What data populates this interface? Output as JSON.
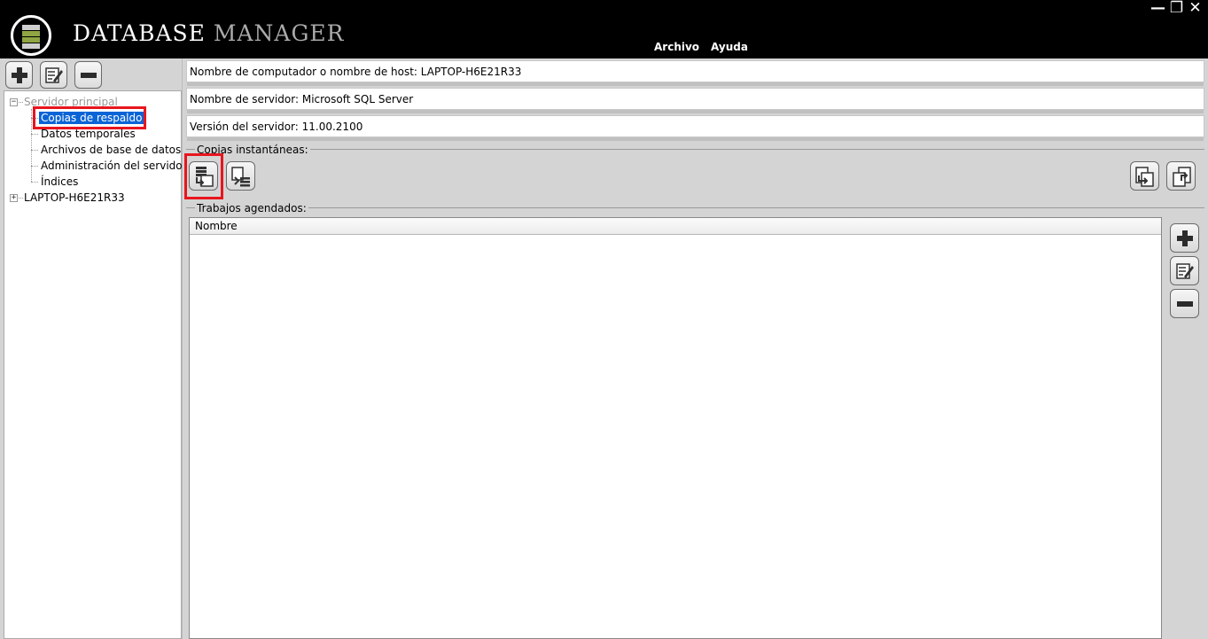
{
  "app": {
    "title_part1": "DATABASE",
    "title_part2": "MANAGER",
    "menu": [
      "Archivo",
      "Ayuda"
    ],
    "window_controls": {
      "minimize": "minimize-icon",
      "restore": "restore-icon",
      "close": "close-icon"
    }
  },
  "left_toolbar": {
    "add": "plus-icon",
    "edit": "edit-icon",
    "remove": "minus-icon"
  },
  "tree": {
    "root": "Servidor principal",
    "children": [
      "Copias de respaldo",
      "Datos temporales",
      "Archivos de base de datos",
      "Administración del servidor",
      "Índices"
    ],
    "second": "LAPTOP-H6E21R33",
    "selected": "Copias de respaldo"
  },
  "info": {
    "host": "Nombre de computador o nombre de host: LAPTOP-H6E21R33",
    "server_name": "Nombre de servidor: Microsoft SQL Server",
    "version": "Versión del servidor: 11.00.2100"
  },
  "snapshots": {
    "label": "Copias instantáneas:",
    "icons": [
      "snapshot-create-icon",
      "snapshot-list-icon",
      "snapshot-export-icon",
      "snapshot-import-icon"
    ]
  },
  "jobs": {
    "label": "Trabajos agendados:",
    "columns": [
      "Nombre"
    ],
    "rows": [],
    "actions": [
      "plus-icon",
      "edit-icon",
      "minus-icon"
    ]
  },
  "colors": {
    "selection": "#0a64d6",
    "highlight": "#e8151e",
    "logo_green": "#8fa642"
  }
}
